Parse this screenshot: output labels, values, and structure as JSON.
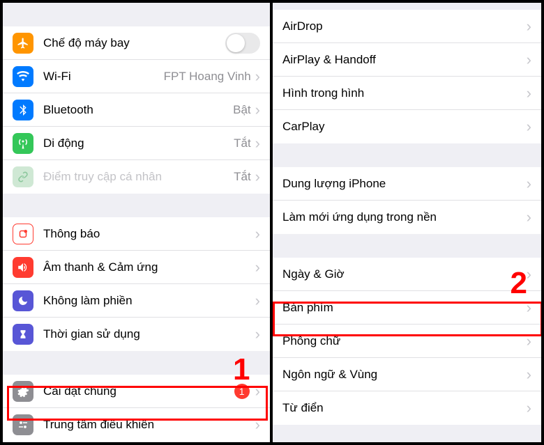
{
  "left": {
    "rows": [
      {
        "id": "airplane",
        "label": "Chế độ máy bay",
        "icon": "airplane",
        "iconColor": "ic-orange",
        "control": "toggle"
      },
      {
        "id": "wifi",
        "label": "Wi-Fi",
        "icon": "wifi",
        "iconColor": "ic-blue",
        "detail": "FPT Hoang Vinh",
        "chevron": true
      },
      {
        "id": "bluetooth",
        "label": "Bluetooth",
        "icon": "bluetooth",
        "iconColor": "ic-blue",
        "detail": "Bật",
        "chevron": true
      },
      {
        "id": "cellular",
        "label": "Di động",
        "icon": "antenna",
        "iconColor": "ic-green",
        "detail": "Tắt",
        "chevron": true
      },
      {
        "id": "hotspot",
        "label": "Điểm truy cập cá nhân",
        "icon": "link",
        "iconColor": "ic-greygr",
        "detail": "Tắt",
        "chevron": true,
        "disabled": true
      }
    ],
    "rows2": [
      {
        "id": "notifications",
        "label": "Thông báo",
        "icon": "bell",
        "iconColor": "ic-redoutline",
        "chevron": true
      },
      {
        "id": "sounds",
        "label": "Âm thanh & Cảm ứng",
        "icon": "speaker",
        "iconColor": "ic-red",
        "chevron": true
      },
      {
        "id": "dnd",
        "label": "Không làm phiền",
        "icon": "moon",
        "iconColor": "ic-indigo",
        "chevron": true
      },
      {
        "id": "screentime",
        "label": "Thời gian sử dụng",
        "icon": "hourglass",
        "iconColor": "ic-indigo",
        "chevron": true
      }
    ],
    "rows3": [
      {
        "id": "general",
        "label": "Cài đặt chung",
        "icon": "gear",
        "iconColor": "ic-grey",
        "badge": "1",
        "chevron": true
      },
      {
        "id": "controlcenter",
        "label": "Trung tâm điều khiển",
        "icon": "sliders",
        "iconColor": "ic-greylt",
        "chevron": true
      }
    ]
  },
  "right": {
    "rows": [
      {
        "id": "airdrop",
        "label": "AirDrop",
        "chevron": true
      },
      {
        "id": "airplay",
        "label": "AirPlay & Handoff",
        "chevron": true
      },
      {
        "id": "pip",
        "label": "Hình trong hình",
        "chevron": true
      },
      {
        "id": "carplay",
        "label": "CarPlay",
        "chevron": true
      }
    ],
    "rows2": [
      {
        "id": "storage",
        "label": "Dung lượng iPhone",
        "chevron": true
      },
      {
        "id": "bgrefresh",
        "label": "Làm mới ứng dụng trong nền",
        "chevron": true
      }
    ],
    "rows3": [
      {
        "id": "datetime",
        "label": "Ngày & Giờ",
        "chevron": true
      },
      {
        "id": "keyboard",
        "label": "Bàn phím",
        "chevron": true
      },
      {
        "id": "fonts",
        "label": "Phông chữ",
        "chevron": true
      },
      {
        "id": "language",
        "label": "Ngôn ngữ & Vùng",
        "chevron": true
      },
      {
        "id": "dictionary",
        "label": "Từ điển",
        "chevron": true
      }
    ]
  },
  "annotations": {
    "step1": "1",
    "step2": "2"
  }
}
